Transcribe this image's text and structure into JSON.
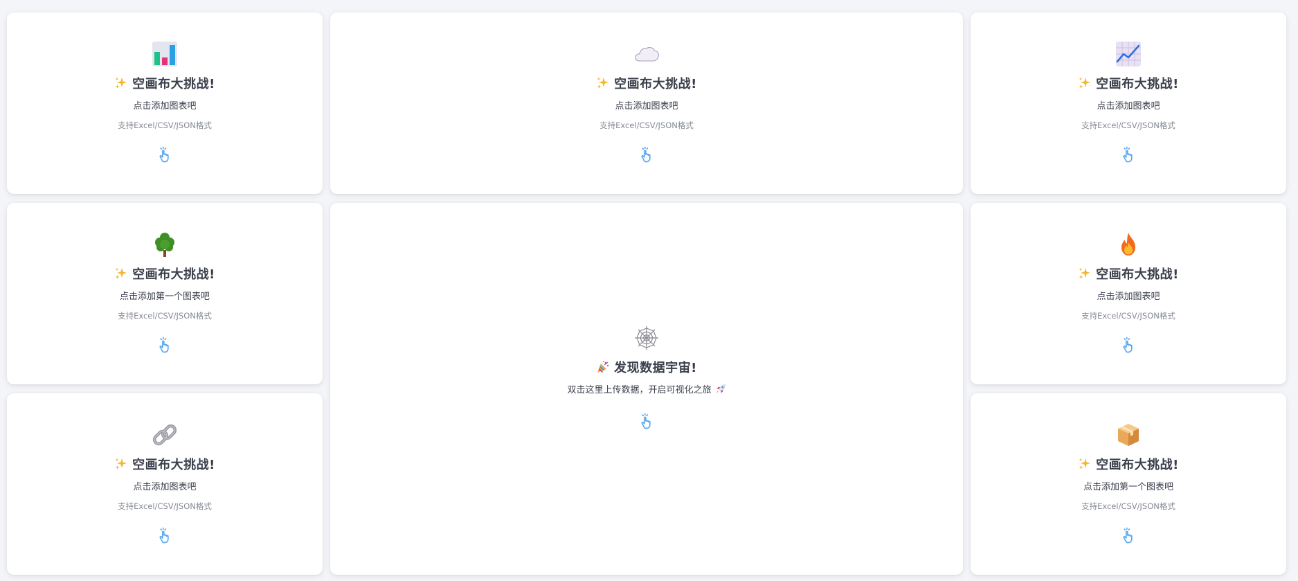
{
  "cards": [
    {
      "icon": "bar-chart-icon",
      "title": "空画布大挑战!",
      "subtitle": "点击添加图表吧",
      "hint": "支持Excel/CSV/JSON格式"
    },
    {
      "icon": "cloud-icon",
      "title": "空画布大挑战!",
      "subtitle": "点击添加图表吧",
      "hint": "支持Excel/CSV/JSON格式"
    },
    {
      "icon": "line-chart-icon",
      "title": "空画布大挑战!",
      "subtitle": "点击添加图表吧",
      "hint": "支持Excel/CSV/JSON格式"
    },
    {
      "icon": "tree-icon",
      "title": "空画布大挑战!",
      "subtitle": "点击添加第一个图表吧",
      "hint": "支持Excel/CSV/JSON格式"
    },
    {
      "icon": "fire-icon",
      "title": "空画布大挑战!",
      "subtitle": "点击添加图表吧",
      "hint": "支持Excel/CSV/JSON格式"
    },
    {
      "icon": "link-icon",
      "title": "空画布大挑战!",
      "subtitle": "点击添加图表吧",
      "hint": "支持Excel/CSV/JSON格式"
    },
    {
      "icon": "package-icon",
      "title": "空画布大挑战!",
      "subtitle": "点击添加第一个图表吧",
      "hint": "支持Excel/CSV/JSON格式"
    }
  ],
  "center": {
    "icon": "spider-web-icon",
    "title": "发现数据宇宙!",
    "subtitle": "双击这里上传数据，开启可视化之旅"
  },
  "colors": {
    "background": "#f4f5f8",
    "card": "#ffffff",
    "title": "#3a3f4b",
    "hint": "#858a96",
    "tap_icon": "#5aa9f0"
  }
}
